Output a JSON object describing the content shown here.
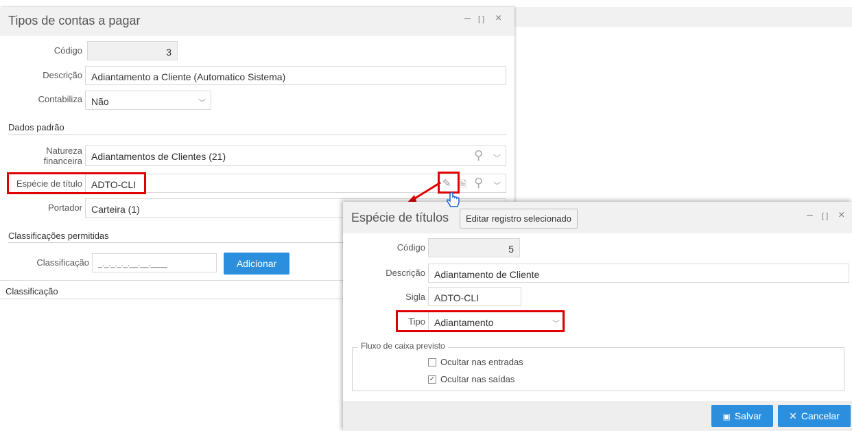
{
  "main_window": {
    "title": "Tipos de contas a pagar",
    "fields": {
      "codigo_label": "Código",
      "codigo_value": "3",
      "descricao_label": "Descrição",
      "descricao_value": "Adiantamento a Cliente (Automatico Sistema)",
      "contabiliza_label": "Contabiliza",
      "contabiliza_value": "Não"
    },
    "section_dados": "Dados padrão",
    "natureza_label_1": "Natureza",
    "natureza_label_2": "financeira",
    "natureza_value": "Adiantamentos de Clientes (21)",
    "especie_label": "Espécie de título",
    "especie_value": "ADTO-CLI",
    "portador_label": "Portador",
    "portador_value": "Carteira (1)",
    "section_classificacoes": "Classificações permitidas",
    "classificacao_label": "Classificação",
    "classificacao_value": "_._._._._.__.__.____",
    "adicionar_label": "Adicionar",
    "table_header": "Classificação"
  },
  "tooltip": "Editar registro selecionado",
  "dialog": {
    "title": "Espécie de títulos",
    "codigo_label": "Código",
    "codigo_value": "5",
    "descricao_label": "Descrição",
    "descricao_value": "Adiantamento de Cliente",
    "sigla_label": "Sigla",
    "sigla_value": "ADTO-CLI",
    "tipo_label": "Tipo",
    "tipo_value": "Adiantamento",
    "fluxo_legend": "Fluxo de caixa previsto",
    "ocultar_entradas": "Ocultar nas entradas",
    "ocultar_saidas": "Ocultar nas saídas",
    "salvar_label": "Salvar",
    "cancelar_label": "Cancelar"
  },
  "window_controls": {
    "minimize": "–",
    "maximize": "⛶",
    "close": "×"
  },
  "colors": {
    "accent": "#2b8fde",
    "highlight": "#e00000"
  }
}
